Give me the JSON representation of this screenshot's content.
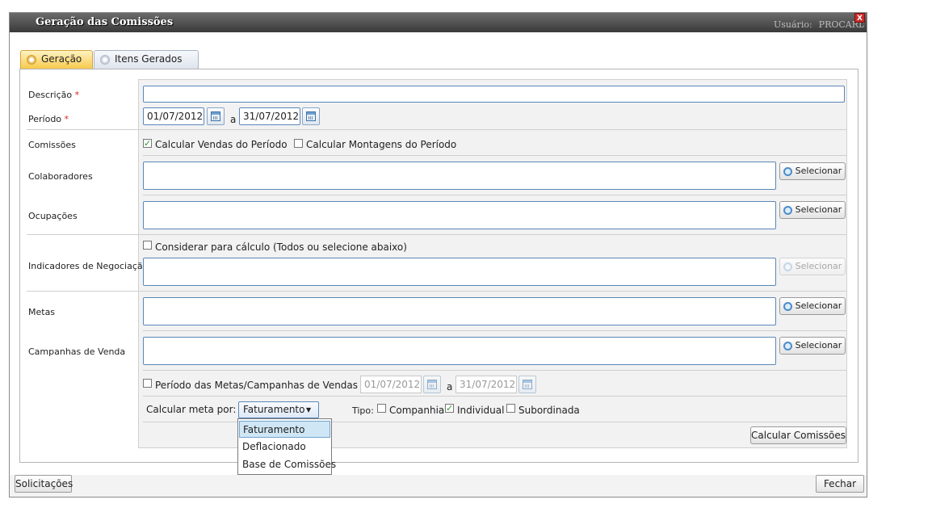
{
  "window": {
    "title": "Geração das Comissões",
    "user_label": "Usuário:",
    "user_name": "PROCARD S",
    "close_label": "X"
  },
  "tabs": [
    {
      "label": "Geração",
      "active": true
    },
    {
      "label": "Itens Gerados",
      "active": false
    }
  ],
  "form": {
    "descricao": {
      "label": "Descrição",
      "required_mark": "*",
      "value": ""
    },
    "periodo": {
      "label": "Período",
      "required_mark": "*",
      "start": "01/07/2012",
      "separator": "a",
      "end": "31/07/2012"
    },
    "comissoes": {
      "label": "Comissões",
      "vendas": {
        "label": "Calcular Vendas do Período",
        "checked": true
      },
      "montagens": {
        "label": "Calcular Montagens do Período",
        "checked": false
      }
    },
    "colaboradores": {
      "label": "Colaboradores",
      "button": "Selecionar"
    },
    "ocupacoes": {
      "label": "Ocupações",
      "button": "Selecionar"
    },
    "indicadores": {
      "label": "Indicadores de Negociação",
      "considerar": {
        "label": "Considerar para cálculo (Todos ou selecione abaixo)",
        "checked": false
      },
      "button": "Selecionar",
      "button_disabled": true
    },
    "metas": {
      "label": "Metas",
      "button": "Selecionar"
    },
    "campanhas": {
      "label": "Campanhas de Venda",
      "button": "Selecionar"
    },
    "periodo_metas": {
      "label": "Período das Metas/Campanhas de Vendas",
      "checked": false,
      "start": "01/07/2012",
      "separator": "a",
      "end": "31/07/2012"
    },
    "calcular_meta": {
      "label": "Calcular meta por:",
      "selected": "Faturamento",
      "options": [
        "Faturamento",
        "Deflacionado",
        "Base de Comissões"
      ],
      "highlighted_option": "Faturamento"
    },
    "tipo": {
      "label": "Tipo:",
      "companhia": {
        "label": "Companhia",
        "checked": false
      },
      "individual": {
        "label": "Individual",
        "checked": true
      },
      "subordinada": {
        "label": "Subordinada",
        "checked": false
      }
    },
    "calcular_button": "Calcular Comissões"
  },
  "footer": {
    "solicitacoes_button": "Solicitações",
    "fechar_button": "Fechar"
  },
  "colors": {
    "titlebar": "#4a4a4a",
    "active_tab": "#f7c94c",
    "input_border": "#5c87b8",
    "check_mark": "#2a9a2a",
    "required": "#dd2222"
  }
}
